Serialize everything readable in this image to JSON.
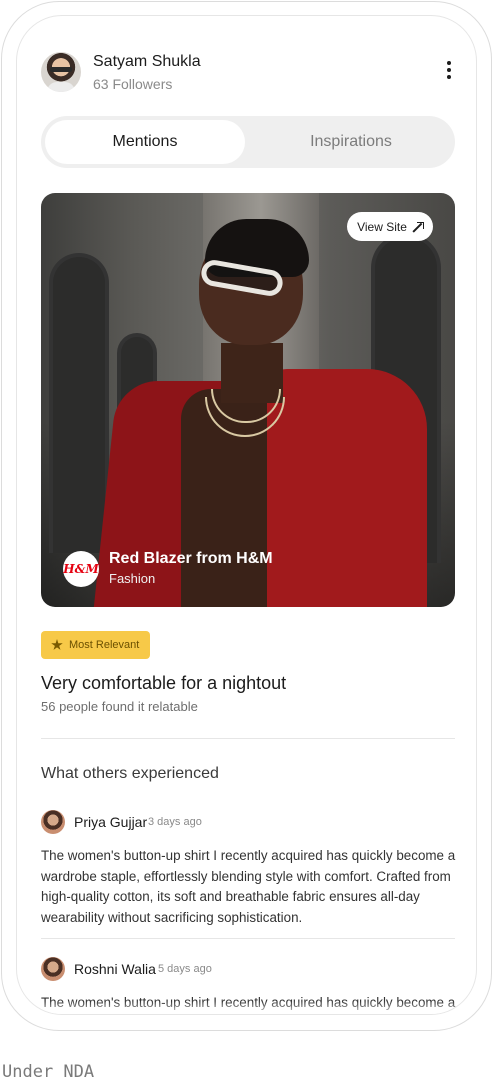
{
  "profile": {
    "name": "Satyam Shukla",
    "followers": "63 Followers"
  },
  "tabs": [
    {
      "label": "Mentions",
      "active": true
    },
    {
      "label": "Inspirations",
      "active": false
    }
  ],
  "hero": {
    "view_site_label": "View Site",
    "brand_logo_text": "H&M",
    "product_name": "Red Blazer from H&M",
    "product_category": "Fashion"
  },
  "relevance": {
    "badge_label": "Most Relevant",
    "headline": "Very comfortable for a nightout",
    "relatable_text": "56 people found it relatable"
  },
  "reviews_section": {
    "title": "What others experienced",
    "reviews": [
      {
        "name": "Priya Gujjar",
        "time": "3 days ago",
        "text": "The women's button-up shirt I recently acquired has quickly become a wardrobe staple, effortlessly blending style with comfort. Crafted from high-quality cotton, its soft and breathable fabric ensures all-day wearability without sacrificing sophistication."
      },
      {
        "name": "Roshni Walia",
        "time": "5 days ago",
        "text": "The women's button-up shirt I recently acquired has quickly become a wardrobe staple, effortlessly blending style with comfort. Crafted from high-quality cotton, its soft and breathable fabric ensures all-day wearability without sacrificing sophistication."
      }
    ]
  },
  "watermark": "Under NDA",
  "colors": {
    "badge": "#f7c948",
    "tab_track": "#efefef",
    "brand_red": "#e50010"
  }
}
